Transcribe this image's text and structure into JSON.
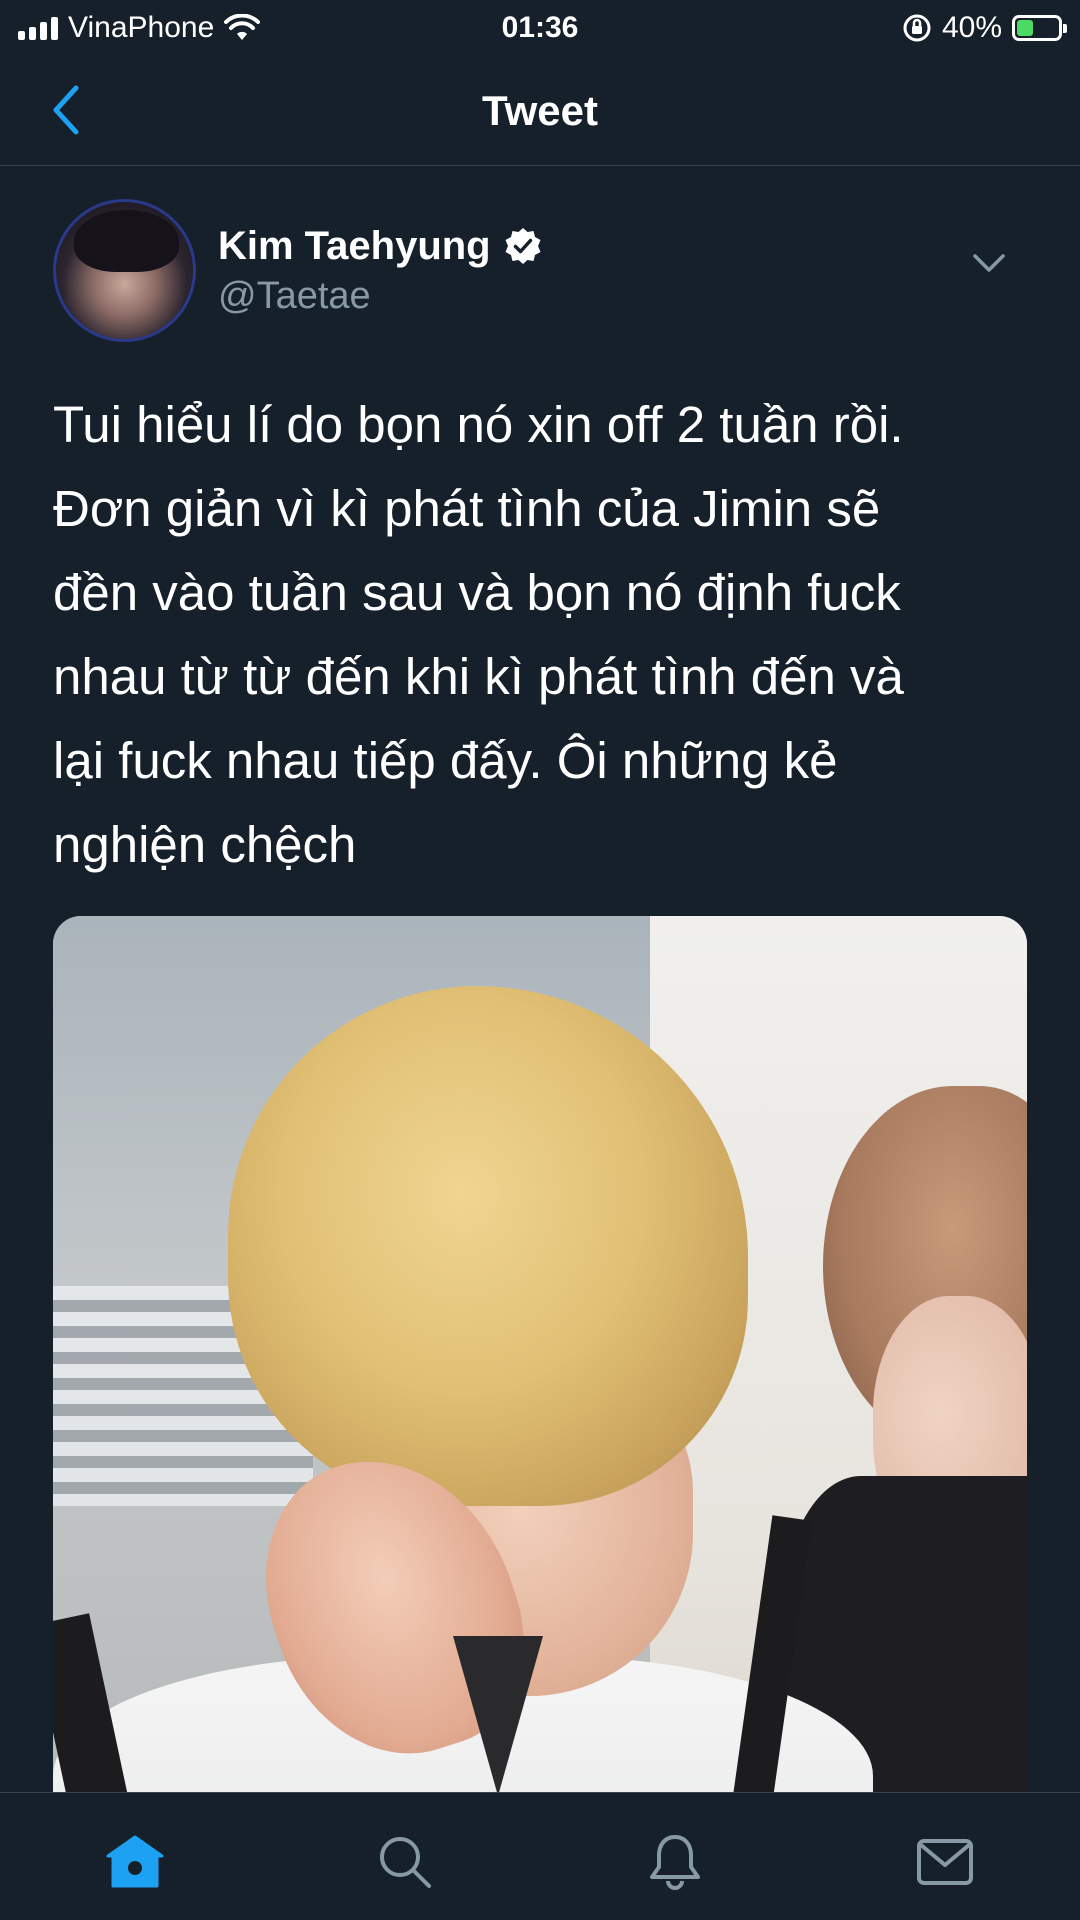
{
  "status_bar": {
    "carrier": "VinaPhone",
    "time": "01:36",
    "battery_percent": "40%",
    "battery_level": 0.4,
    "icons": [
      "signal-icon",
      "wifi-icon",
      "orientation-lock-icon",
      "battery-charging-icon"
    ]
  },
  "header": {
    "title": "Tweet",
    "back_icon": "chevron-left-icon"
  },
  "tweet": {
    "author_name": "Kim Taehyung",
    "author_handle": "@Taetae",
    "verified": true,
    "text": "Tui hiểu lí do bọn nó xin off 2 tuần rồi.\nĐơn giản vì kì phát tình của Jimin sẽ\nđền vào tuần sau và bọn nó định fuck\nnhau từ từ đến khi kì phát tình đến và\nlại fuck nhau tiếp đấy. Ôi những kẻ\nnghiện chệch",
    "more_icon": "chevron-down-icon",
    "media": "photo"
  },
  "tab_bar": {
    "items": [
      "home-icon",
      "search-icon",
      "notifications-icon",
      "messages-icon"
    ],
    "active": "home-icon"
  },
  "colors": {
    "background": "#15202b",
    "accent": "#1da1f2",
    "secondary_text": "#8899a6",
    "divider": "#38444d"
  }
}
